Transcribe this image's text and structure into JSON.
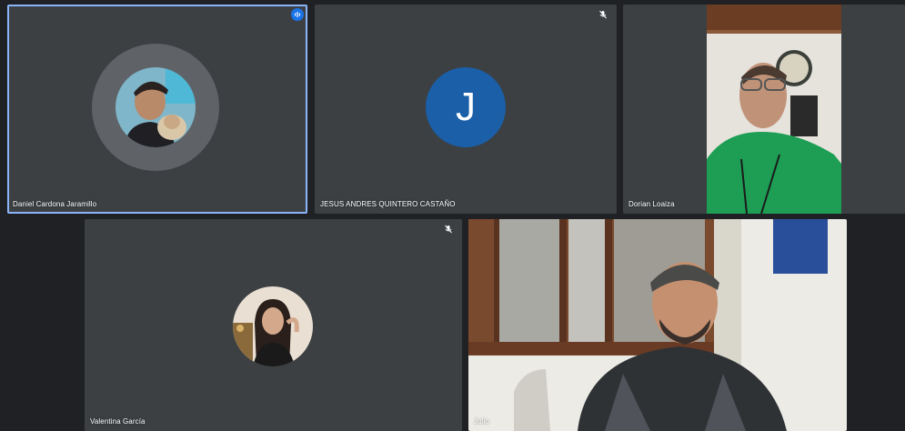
{
  "participants": [
    {
      "name": "Daniel Cardona Jaramillo",
      "status": "speaking",
      "avatar": "photo"
    },
    {
      "name": "JESUS ANDRES QUINTERO CASTAÑO",
      "status": "muted",
      "avatar_letter": "J",
      "avatar_color": "#1a5fa8"
    },
    {
      "name": "Dorian Loaiza",
      "status": "video-on"
    },
    {
      "name": "Valentina García",
      "status": "muted",
      "avatar": "photo"
    },
    {
      "name": "Julio",
      "status": "video-on"
    }
  ],
  "colors": {
    "background": "#202124",
    "tile": "#3c4043",
    "active_border": "#8ab4f8",
    "speaking_indicator": "#1a73e8"
  }
}
